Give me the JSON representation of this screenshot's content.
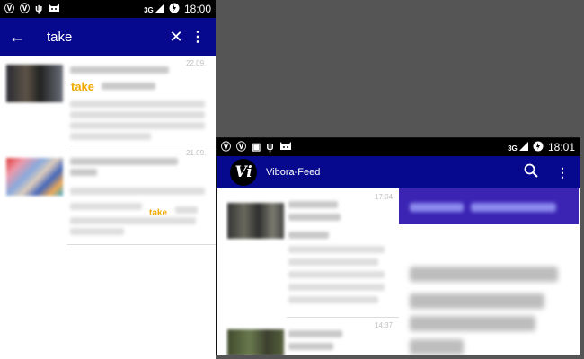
{
  "left_screen": {
    "status_time": "18:00",
    "status_network": "3G",
    "search_query": "take",
    "results": [
      {
        "date": "22.09.",
        "highlight": "take"
      },
      {
        "date": "21.09.",
        "highlight": "take"
      }
    ]
  },
  "right_screen": {
    "status_time": "18:01",
    "status_network": "3G",
    "logo_text": "Vi",
    "app_title": "Vibora-Feed",
    "items": [
      {
        "time": "17:04"
      },
      {
        "time": "14:37"
      }
    ]
  },
  "colors": {
    "toolbar": "#06088e",
    "highlight": "#f2a900",
    "banner": "#3b24b4",
    "background": "#555555"
  },
  "icons": [
    "vibora-logo-icon",
    "usb-icon",
    "cat-icon",
    "signal-icon",
    "battery-icon",
    "image-icon",
    "back-arrow-icon",
    "close-icon",
    "more-vert-icon",
    "search-icon"
  ]
}
